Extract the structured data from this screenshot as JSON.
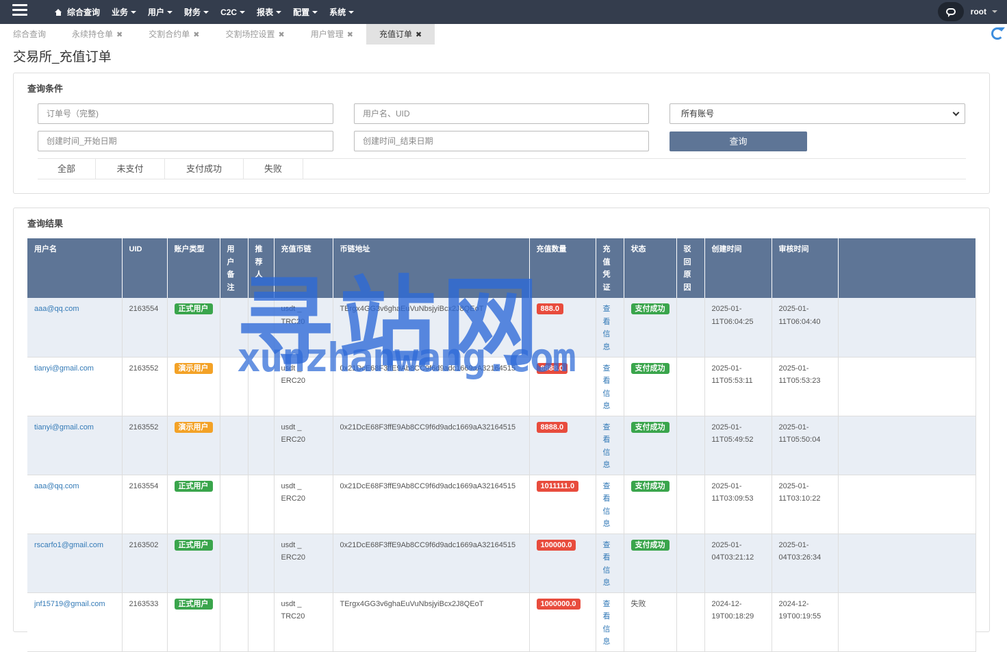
{
  "nav": {
    "items": [
      {
        "label": "综合查询",
        "icon": "home-icon"
      },
      {
        "label": "业务"
      },
      {
        "label": "用户"
      },
      {
        "label": "财务"
      },
      {
        "label": "C2C"
      },
      {
        "label": "报表"
      },
      {
        "label": "配置"
      },
      {
        "label": "系统"
      }
    ],
    "username": "root",
    "chat_icon": "chat-icon",
    "menu_icon": "hamburger-menu-icon"
  },
  "tabs": [
    {
      "label": "综合查询",
      "closable": false,
      "active": false
    },
    {
      "label": "永续持仓单",
      "closable": true,
      "active": false
    },
    {
      "label": "交割合约单",
      "closable": true,
      "active": false
    },
    {
      "label": "交割场控设置",
      "closable": true,
      "active": false
    },
    {
      "label": "用户管理",
      "closable": true,
      "active": false
    },
    {
      "label": "充值订单",
      "closable": true,
      "active": true
    }
  ],
  "page_title": "交易所_充值订单",
  "query": {
    "title": "查询条件",
    "order_placeholder": "订单号（完整)",
    "user_placeholder": "用户名、UID",
    "account_select": "所有账号",
    "start_placeholder": "创建时间_开始日期",
    "end_placeholder": "创建时间_结束日期",
    "search_label": "查询",
    "filters": [
      "全部",
      "未支付",
      "支付成功",
      "失败"
    ]
  },
  "results": {
    "title": "查询结果",
    "headers": [
      "用户名",
      "UID",
      "账户类型",
      "用户备注",
      "推荐人",
      "充值币链",
      "币链地址",
      "充值数量",
      "充值凭证",
      "状态",
      "驳回原因",
      "创建时间",
      "审核时间"
    ],
    "rows": [
      {
        "user": "aaa@qq.com",
        "uid": "2163554",
        "type": "正式用户",
        "type_color": "#3aa54c",
        "chain": "usdt _ TRC20",
        "address": "TErgx4GG3v6ghaEuVuNbsjyiBcx2J8QEoT",
        "amount": "888.0",
        "proof": "查看信息",
        "status": "支付成功",
        "status_badge": true,
        "created": "2025-01-11T06:04:25",
        "reviewed": "2025-01-11T06:04:40"
      },
      {
        "user": "tianyi@gmail.com",
        "uid": "2163552",
        "type": "演示用户",
        "type_color": "#f3a227",
        "chain": "usdt _ ERC20",
        "address": "0x21DcE68F3ffE9Ab8CC9f6d9adc1669aA32164515",
        "amount": "8888.0",
        "proof": "查看信息",
        "status": "支付成功",
        "status_badge": true,
        "created": "2025-01-11T05:53:11",
        "reviewed": "2025-01-11T05:53:23"
      },
      {
        "user": "tianyi@gmail.com",
        "uid": "2163552",
        "type": "演示用户",
        "type_color": "#f3a227",
        "chain": "usdt _ ERC20",
        "address": "0x21DcE68F3ffE9Ab8CC9f6d9adc1669aA32164515",
        "amount": "8888.0",
        "proof": "查看信息",
        "status": "支付成功",
        "status_badge": true,
        "created": "2025-01-11T05:49:52",
        "reviewed": "2025-01-11T05:50:04"
      },
      {
        "user": "aaa@qq.com",
        "uid": "2163554",
        "type": "正式用户",
        "type_color": "#3aa54c",
        "chain": "usdt _ ERC20",
        "address": "0x21DcE68F3ffE9Ab8CC9f6d9adc1669aA32164515",
        "amount": "1011111.0",
        "proof": "查看信息",
        "status": "支付成功",
        "status_badge": true,
        "created": "2025-01-11T03:09:53",
        "reviewed": "2025-01-11T03:10:22"
      },
      {
        "user": "rscarfo1@gmail.com",
        "uid": "2163502",
        "type": "正式用户",
        "type_color": "#3aa54c",
        "chain": "usdt _ ERC20",
        "address": "0x21DcE68F3ffE9Ab8CC9f6d9adc1669aA32164515",
        "amount": "100000.0",
        "proof": "查看信息",
        "status": "支付成功",
        "status_badge": true,
        "created": "2025-01-04T03:21:12",
        "reviewed": "2025-01-04T03:26:34"
      },
      {
        "user": "jnf15719@gmail.com",
        "uid": "2163533",
        "type": "正式用户",
        "type_color": "#3aa54c",
        "chain": "usdt _ TRC20",
        "address": "TErgx4GG3v6ghaEuVuNbsjyiBcx2J8QEoT",
        "amount": "1000000.0",
        "proof": "查看信息",
        "status": "失败",
        "status_badge": false,
        "created": "2024-12-19T00:18:29",
        "reviewed": "2024-12-19T00:19:55"
      }
    ]
  },
  "watermark": {
    "cn": "寻站网",
    "en": "xunzhanwang.com"
  },
  "colors": {
    "nav_bg": "#343d4d",
    "header_bg": "#5e7596",
    "accent": "#337ab7",
    "success": "#3aa54c",
    "warning": "#f3a227",
    "danger": "#e84c3d"
  }
}
